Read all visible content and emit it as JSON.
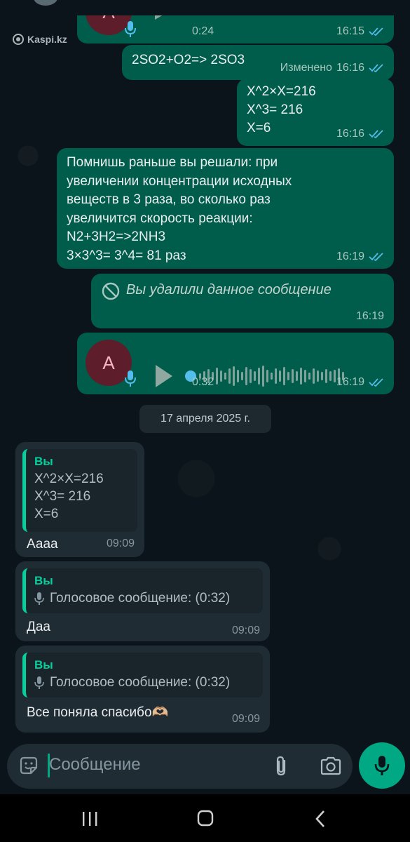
{
  "watermark": "Kaspi.kz",
  "messages": {
    "top_voice": {
      "duration": "0:24",
      "time": "16:15"
    },
    "m1": {
      "text": "2SO2+O2=> 2SO3",
      "edited": "Изменено",
      "time": "16:16"
    },
    "m2": {
      "text": "X^2×X=216\nX^3= 216\nX=6",
      "time": "16:16"
    },
    "m3": {
      "text": "Помнишь раньше вы решали: при\nувеличении концентрации исходных\nвеществ в 3 раза, во сколько раз\nувеличится скорость реакции:\nN2+3H2=>2NH3\n3×3^3= 3^4= 81 раз",
      "time": "16:19"
    },
    "m4": {
      "text": "Вы удалили данное сообщение",
      "time": "16:19"
    },
    "voice": {
      "avatar_letter": "A",
      "duration": "0:32",
      "time": "16:19"
    }
  },
  "date_separator": "17 апреля 2025 г.",
  "incoming": [
    {
      "quote_author": "Вы",
      "quote_text": "X^2×X=216\nX^3= 216\nX=6",
      "text": "Аааа",
      "time": "09:09"
    },
    {
      "quote_author": "Вы",
      "quote_voice": "Голосовое сообщение: (0:32)",
      "text": "Даа",
      "time": "09:09"
    },
    {
      "quote_author": "Вы",
      "quote_voice": "Голосовое сообщение: (0:32)",
      "text": "Все поняла спасибо🫶🏼",
      "time": "09:09"
    }
  ],
  "composer": {
    "placeholder": "Сообщение"
  },
  "icons": {
    "emoji": "sticker-smile-icon",
    "attach": "paperclip-icon",
    "camera": "camera-icon",
    "mic": "microphone-icon",
    "tick": "double-check-icon",
    "deleted": "ban-icon",
    "play": "play-icon"
  },
  "colors": {
    "outgoing_bubble": "#005c4b",
    "incoming_bubble": "#202c33",
    "accent": "#00a884",
    "read_ticks": "#53bdeb",
    "reply_bar": "#06cf9c"
  }
}
